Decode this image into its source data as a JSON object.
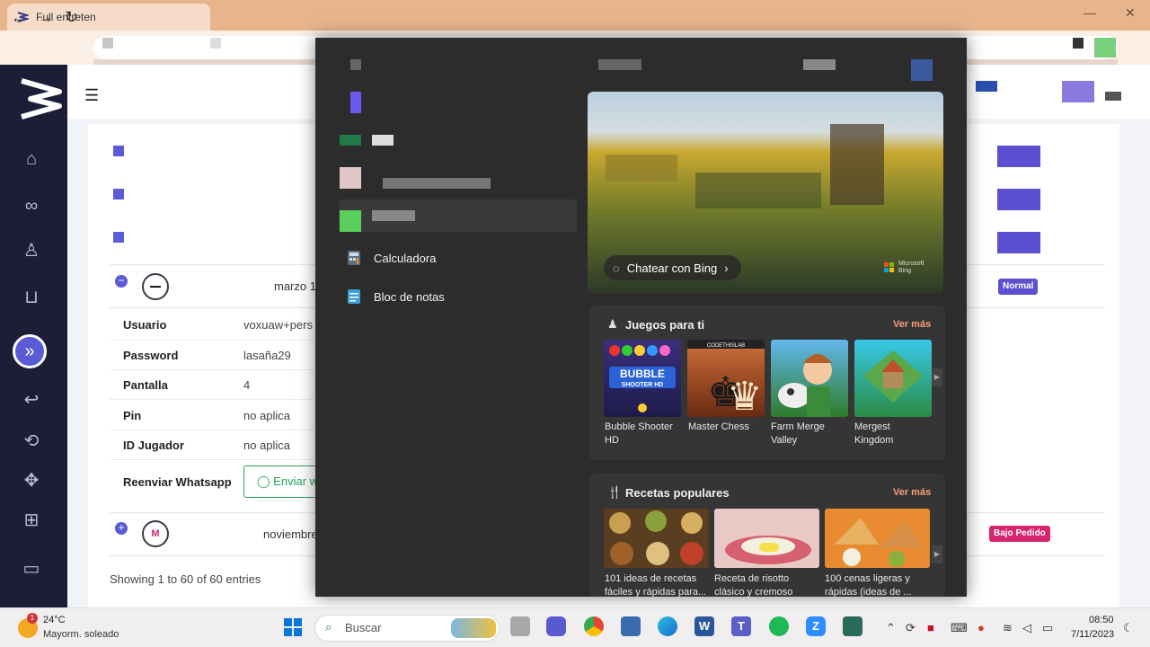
{
  "browser": {
    "tab_title": "Full entreten",
    "minimize": "—",
    "close": "✕",
    "back": "←",
    "forward": "→",
    "reload": "↻"
  },
  "app": {
    "menu_toggle": "☰",
    "active_nav_glyph": "»",
    "rows": [
      {
        "date": "marzo 1",
        "badge": "Normal",
        "badge_color": "#5c4fd0",
        "logo": "netflix"
      },
      {
        "date": "noviembre",
        "badge": "Bajo Pedido",
        "badge_color": "#d6246e",
        "logo": "M"
      }
    ],
    "details": [
      {
        "label": "Usuario",
        "value": "voxuaw+pers"
      },
      {
        "label": "Password",
        "value": "lasaña29"
      },
      {
        "label": "Pantalla",
        "value": "4"
      },
      {
        "label": "Pin",
        "value": "no aplica"
      },
      {
        "label": "ID Jugador",
        "value": "no aplica"
      }
    ],
    "resend_label": "Reenviar Whatsapp",
    "resend_button": "Enviar w",
    "showing": "Showing 1 to 60 of 60 entries"
  },
  "start_menu": {
    "apps": [
      {
        "label": "Calculadora",
        "icon": "calculator-icon"
      },
      {
        "label": "Bloc de notas",
        "icon": "notepad-icon"
      }
    ],
    "chat_bing": "Chatear con Bing",
    "ms_bing": [
      "Microsoft",
      "Bing"
    ],
    "games_title": "Juegos para ti",
    "see_more": "Ver más",
    "games": [
      {
        "name": "Bubble Shooter HD",
        "colors": [
          "#3a2f7c",
          "#1d1b4a"
        ]
      },
      {
        "name": "Master Chess",
        "colors": [
          "#c4602a",
          "#7a2f12"
        ]
      },
      {
        "name": "Farm Merge Valley",
        "colors": [
          "#63b8ee",
          "#2e7c2a"
        ]
      },
      {
        "name": "Mergest Kingdom",
        "colors": [
          "#38c8e8",
          "#2a8c44"
        ]
      }
    ],
    "recipes_title": "Recetas populares",
    "recipes": [
      {
        "name": "101 ideas de recetas fáciles y rápidas para...",
        "colors": [
          "#6a4a2a",
          "#c08a3a"
        ]
      },
      {
        "name": "Receta de risotto clásico y cremoso",
        "colors": [
          "#e8c9c9",
          "#d06a7a"
        ]
      },
      {
        "name": "100 cenas ligeras y rápidas (ideas de ...",
        "colors": [
          "#f0a030",
          "#c85a20"
        ]
      }
    ]
  },
  "taskbar": {
    "temperature": "24°C",
    "weather": "Mayorm. soleado",
    "weather_badge": "1",
    "search_placeholder": "Buscar",
    "time": "08:50",
    "date": "7/11/2023"
  }
}
